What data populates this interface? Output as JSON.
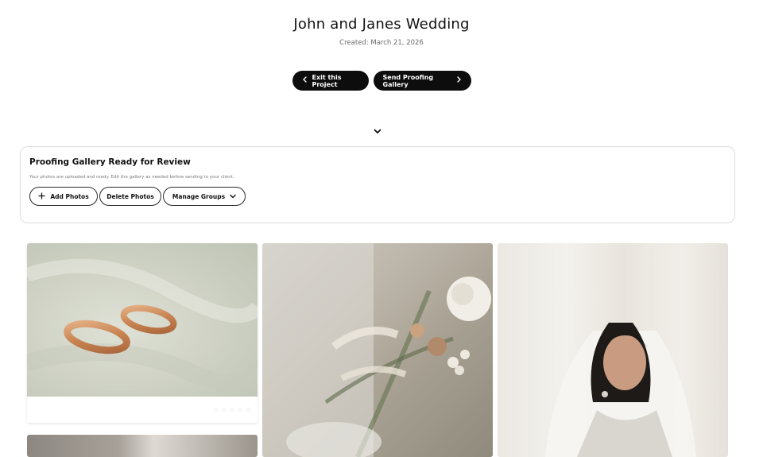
{
  "project": {
    "title": "John and Janes Wedding",
    "created": "Created: March 21, 2026"
  },
  "actions": {
    "exit_label": "Exit this Project",
    "send_label": "Send Proofing Gallery"
  },
  "review_card": {
    "title": "Proofing Gallery Ready for Review",
    "description": "Your photos are uploaded and ready. Edit the gallery as needed before sending to your client.",
    "add_label": "Add Photos",
    "delete_label": "Delete Photos",
    "manage_label": "Manage Groups"
  },
  "gallery": {
    "photos": [
      {
        "subject": "wedding-rings",
        "rating": 0,
        "rating_max": 5
      },
      {
        "subject": "bridal-bouquet"
      },
      {
        "subject": "bride-portrait"
      },
      {
        "subject": "bride-veil"
      }
    ]
  },
  "icons": {
    "exit": "chevron-left-icon",
    "send": "chevron-right-icon",
    "collapse": "chevron-down-icon",
    "add": "plus-icon",
    "manage": "chevron-down-icon",
    "rating": "star-icon"
  },
  "colors": {
    "primary_button": "#0d0d0d",
    "primary_button_text": "#ffffff",
    "card_border": "#dcdcdc",
    "star_empty": "#d6d6d6"
  }
}
